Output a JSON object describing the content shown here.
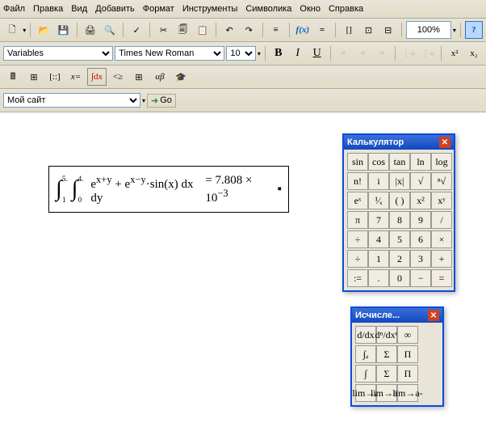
{
  "menu": {
    "file": "Файл",
    "edit": "Правка",
    "view": "Вид",
    "insert": "Добавить",
    "format": "Формат",
    "tools": "Инструменты",
    "symbols": "Символика",
    "window": "Окно",
    "help": "Справка"
  },
  "tb1": {
    "new": "🗋",
    "open": "📂",
    "save": "💾",
    "print": "🖨",
    "preview": "🔍",
    "spell": "✓",
    "cut": "✂",
    "copy": "🗐",
    "paste": "📋",
    "undo": "↶",
    "redo": "↷",
    "align": "≡",
    "fx": "f(x)",
    "eq": "=",
    "brackets": "[]",
    "zoom": "100%",
    "help": "?"
  },
  "tb2": {
    "style": "Variables",
    "font": "Times New Roman",
    "size": "10",
    "bold": "B",
    "italic": "I",
    "underline": "U",
    "x2": "x²",
    "xsub": "x₂"
  },
  "tb3": {
    "graph": "⊞",
    "mat": "[::]",
    "xeq": "x=",
    "int": "∫dx",
    "lt": "<≥",
    "sum": "∑",
    "ab": "αβ",
    "cap": "🎓"
  },
  "tb4": {
    "site": "Мой сайт",
    "go": "Go"
  },
  "formula": {
    "int1_low": "1",
    "int1_up": "5.",
    "int2_low": "0",
    "int2_up": "4.",
    "body": "eˣ⁺ʸ + eˣ⁻ʸ·sin(x) dx dy",
    "result": "= 7.808 × 10⁻³"
  },
  "calc": {
    "title": "Калькулятор",
    "rows": [
      [
        "sin",
        "cos",
        "tan",
        "ln",
        "log"
      ],
      [
        "n!",
        "i",
        "|x|",
        "√",
        "ⁿ√"
      ],
      [
        "eˣ",
        "¹⁄ₓ",
        "( )",
        "x²",
        "xʸ"
      ],
      [
        "π",
        "7",
        "8",
        "9",
        "/"
      ],
      [
        "÷",
        "4",
        "5",
        "6",
        "×"
      ],
      [
        "÷",
        "1",
        "2",
        "3",
        "+"
      ],
      [
        ":=",
        ".",
        "0",
        "−",
        "="
      ]
    ]
  },
  "calc2": {
    "title": "Исчисле...",
    "rows": [
      [
        "d/dx",
        "dⁿ/dxⁿ",
        "∞",
        ""
      ],
      [
        "∫ₐ",
        "Σ",
        "Π",
        ""
      ],
      [
        "∫",
        "Σ",
        "Π",
        ""
      ],
      [
        "lim→a",
        "lim→a+",
        "lim→a-",
        ""
      ]
    ]
  }
}
